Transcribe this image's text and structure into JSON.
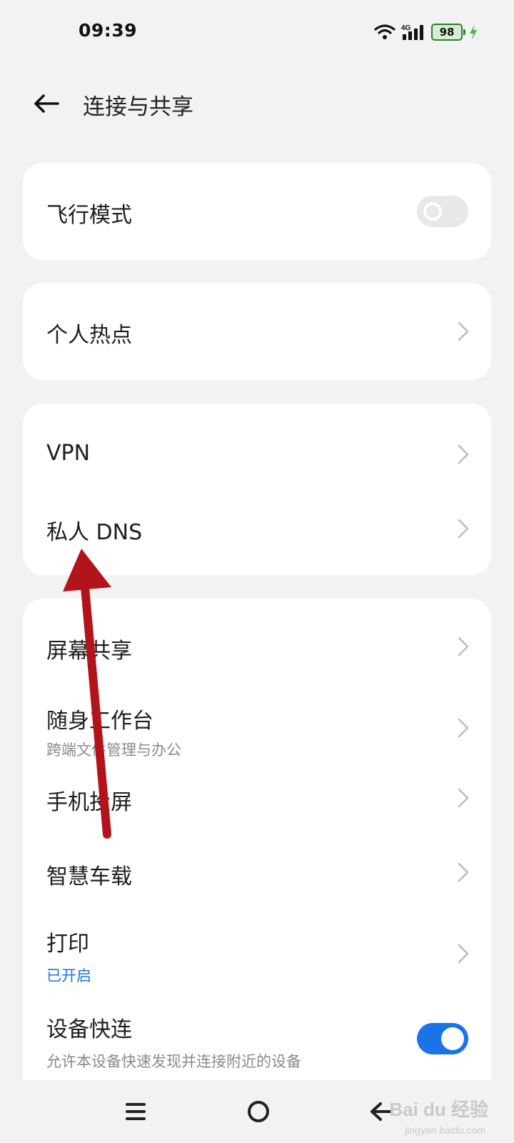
{
  "status_bar": {
    "time": "09:39",
    "network": "4G",
    "battery": "98",
    "icons": [
      "wifi-icon",
      "signal-4g-icon",
      "battery-icon",
      "charging-icon"
    ]
  },
  "header": {
    "title": "连接与共享",
    "back_icon": "arrow-left-icon"
  },
  "sections": [
    {
      "items": [
        {
          "label": "飞行模式",
          "control": "toggle",
          "toggle_on": false
        }
      ]
    },
    {
      "items": [
        {
          "label": "个人热点",
          "control": "chevron"
        }
      ]
    },
    {
      "items": [
        {
          "label": "VPN",
          "control": "chevron"
        },
        {
          "label": "私人 DNS",
          "control": "chevron"
        }
      ]
    },
    {
      "items": [
        {
          "label": "屏幕共享",
          "control": "chevron"
        },
        {
          "label": "随身工作台",
          "subtitle": "跨端文件管理与办公",
          "control": "chevron"
        },
        {
          "label": "手机投屏",
          "control": "chevron"
        },
        {
          "label": "智慧车载",
          "control": "chevron"
        },
        {
          "label": "打印",
          "subtitle": "已开启",
          "control": "chevron"
        },
        {
          "label": "设备快连",
          "subtitle": "允许本设备快速发现并连接附近的设备",
          "control": "toggle",
          "toggle_on": true
        }
      ]
    }
  ],
  "nav_bar": {
    "buttons": [
      "menu-icon",
      "home-circle-icon",
      "back-icon"
    ]
  },
  "annotation": {
    "type": "red-arrow",
    "points_to": "私人 DNS"
  },
  "watermark": {
    "text": "Bai du 经验",
    "sub": "jingyan.baidu.com"
  },
  "colors": {
    "background": "#f2f2f2",
    "card": "#ffffff",
    "accent": "#1a73e8",
    "arrow": "#b3131a",
    "battery_green": "#2e7d32"
  }
}
